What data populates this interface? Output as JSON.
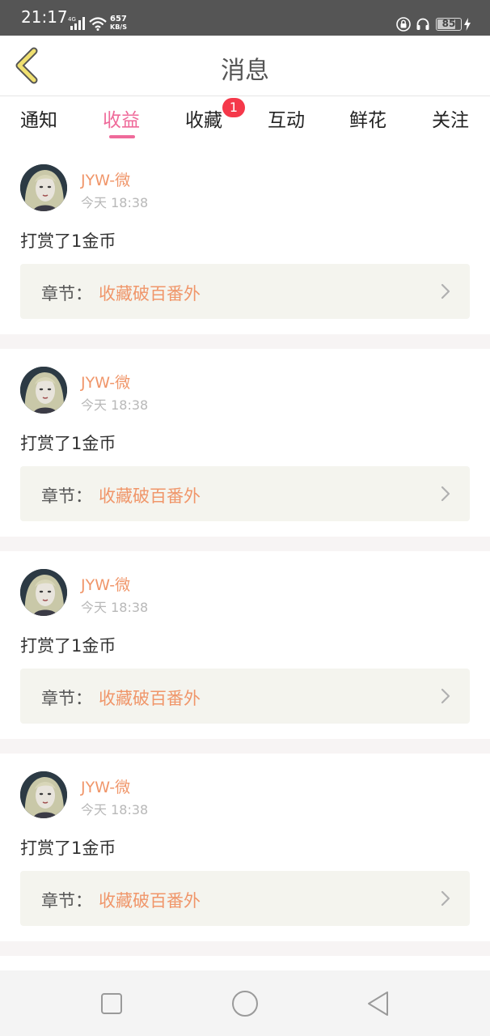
{
  "status_bar": {
    "time": "21:17",
    "network": "4G",
    "speed_value": "657",
    "speed_unit": "KB/S",
    "battery": "85",
    "battery_level": 0.85
  },
  "header": {
    "title": "消息"
  },
  "tabs": [
    {
      "label": "通知",
      "active": false
    },
    {
      "label": "收益",
      "active": true
    },
    {
      "label": "收藏",
      "active": false,
      "badge": "1"
    },
    {
      "label": "互动",
      "active": false
    },
    {
      "label": "鲜花",
      "active": false
    },
    {
      "label": "关注",
      "active": false
    }
  ],
  "messages": [
    {
      "username": "JYW-微",
      "time": "今天 18:38",
      "text": "打赏了1金币",
      "chapter_label": "章节：",
      "chapter_name": "收藏破百番外"
    },
    {
      "username": "JYW-微",
      "time": "今天 18:38",
      "text": "打赏了1金币",
      "chapter_label": "章节：",
      "chapter_name": "收藏破百番外"
    },
    {
      "username": "JYW-微",
      "time": "今天 18:38",
      "text": "打赏了1金币",
      "chapter_label": "章节：",
      "chapter_name": "收藏破百番外"
    },
    {
      "username": "JYW-微",
      "time": "今天 18:38",
      "text": "打赏了1金币",
      "chapter_label": "章节：",
      "chapter_name": "收藏破百番外"
    }
  ],
  "colors": {
    "accent_pink": "#ef6a9a",
    "accent_orange": "#f0966a",
    "badge_red": "#f5384a",
    "back_arrow_yellow": "#f0e070"
  },
  "icons": [
    "back-arrow-icon",
    "chevron-right-icon",
    "square-icon",
    "circle-icon",
    "triangle-back-icon",
    "wifi-icon",
    "signal-icon",
    "lock-icon",
    "headphone-icon",
    "bolt-icon"
  ]
}
